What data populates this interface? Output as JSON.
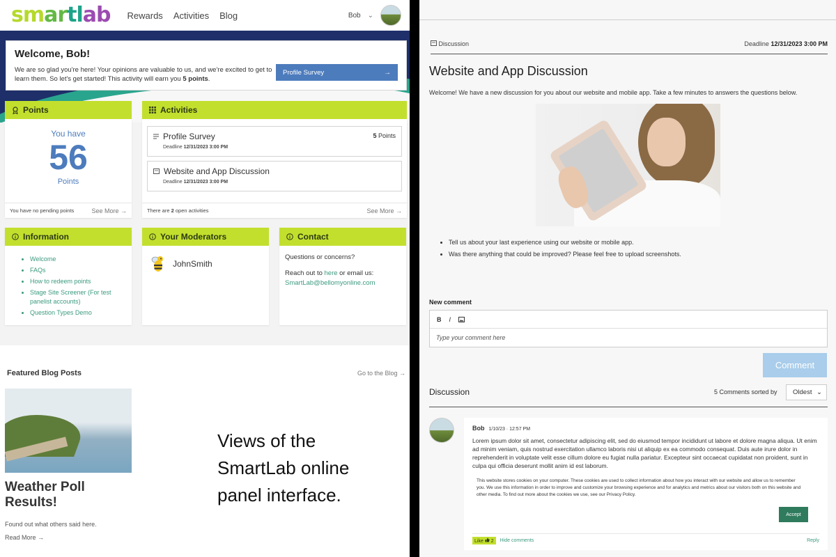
{
  "left": {
    "logo": {
      "p1": "sm",
      "p2": "ar",
      "p3": "tl",
      "p4": "ab"
    },
    "nav": [
      "Rewards",
      "Activities",
      "Blog"
    ],
    "user": {
      "name": "Bob",
      "chevron": "⌄"
    },
    "welcome": {
      "title": "Welcome, Bob!",
      "text": "We are so glad you're here! Your opinions are valuable to us, and we're excited to get to learn them. So let's get started! This activity will earn you",
      "points": "5 points",
      "period": ".",
      "button": "Profile Survey",
      "button_arrow": "→"
    },
    "points_card": {
      "title": "Points",
      "you_have": "You have",
      "value": "56",
      "unit": "Points",
      "footer": "You have no pending points",
      "see_more": "See More →"
    },
    "activities_card": {
      "title": "Activities",
      "items": [
        {
          "title": "Profile Survey",
          "deadline_label": "Deadline",
          "deadline": "12/31/2023 3:00 PM",
          "points_num": "5",
          "points_label": "Points"
        },
        {
          "title": "Website and App Discussion",
          "deadline_label": "Deadline",
          "deadline": "12/31/2023 3:00 PM"
        }
      ],
      "footer_pre": "There are",
      "footer_count": "2",
      "footer_post": "open activities",
      "see_more": "See More →"
    },
    "information_card": {
      "title": "Information",
      "links": [
        "Welcome",
        "FAQs",
        "How to redeem points",
        "Stage Site Screener (For test panelist accounts)",
        "Question Types Demo"
      ]
    },
    "moderators_card": {
      "title": "Your Moderators",
      "name": "JohnSmith"
    },
    "contact_card": {
      "title": "Contact",
      "line1": "Questions or concerns?",
      "line2_pre": "Reach out to",
      "line2_link": "here",
      "line2_post": "or email us:",
      "email": "SmartLab@bellomyonline.com"
    },
    "blog": {
      "heading": "Featured Blog Posts",
      "go": "Go to the Blog →",
      "post_title": "Weather Poll Results!",
      "post_desc": "Found out what others said here.",
      "read_more": "Read More →"
    },
    "caption": "Views of the SmartLab online panel interface."
  },
  "right": {
    "header_label": "Discussion",
    "deadline_label": "Deadline",
    "deadline": "12/31/2023 3:00 PM",
    "title": "Website and App Discussion",
    "intro": "Welcome! We have a new discussion for you about our website and mobile app. Take a few minutes to answers the questions below.",
    "bullets": [
      "Tell us about your last experience using our website or mobile app.",
      "Was there anything that could be improved? Please feel free to upload screenshots."
    ],
    "new_comment_label": "New comment",
    "editor_tools": {
      "bold": "B",
      "italic": "I"
    },
    "editor_placeholder": "Type your comment here",
    "comment_button": "Comment",
    "discussion_label": "Discussion",
    "sort_text": "5 Comments sorted by",
    "sort_value": "Oldest",
    "sort_chevron": "⌄",
    "comment": {
      "author": "Bob",
      "timestamp": "1/10/23 · 12:57 PM",
      "body": "Lorem ipsum dolor sit amet, consectetur adipiscing elit, sed do eiusmod tempor incididunt ut labore et dolore magna aliqua. Ut enim ad minim veniam, quis nostrud exercitation ullamco laboris nisi ut aliquip ex ea commodo consequat. Duis aute irure dolor in reprehenderit in voluptate velit esse cillum dolore eu fugiat nulla pariatur. Excepteur sint occaecat cupidatat non proident, sunt in culpa qui officia deserunt mollit anim id est laborum.",
      "cookie": "This website stores cookies on your computer. These cookies are used to collect information about how you interact with our website and allow us to remember you. We use this information in order to improve and customize your browsing experience and for analytics and metrics about our visitors both on this website and other media. To find out more about the cookies we use, see our Privacy Policy.",
      "accept": "Accept",
      "like": "Like",
      "like_count": "2",
      "hide": "Hide comments",
      "reply": "Reply"
    }
  },
  "colors": {
    "accent_green": "#c3df2e",
    "blue": "#4d7cbd",
    "teal_link": "#3c9a7f",
    "navy": "#1e2f6a"
  }
}
